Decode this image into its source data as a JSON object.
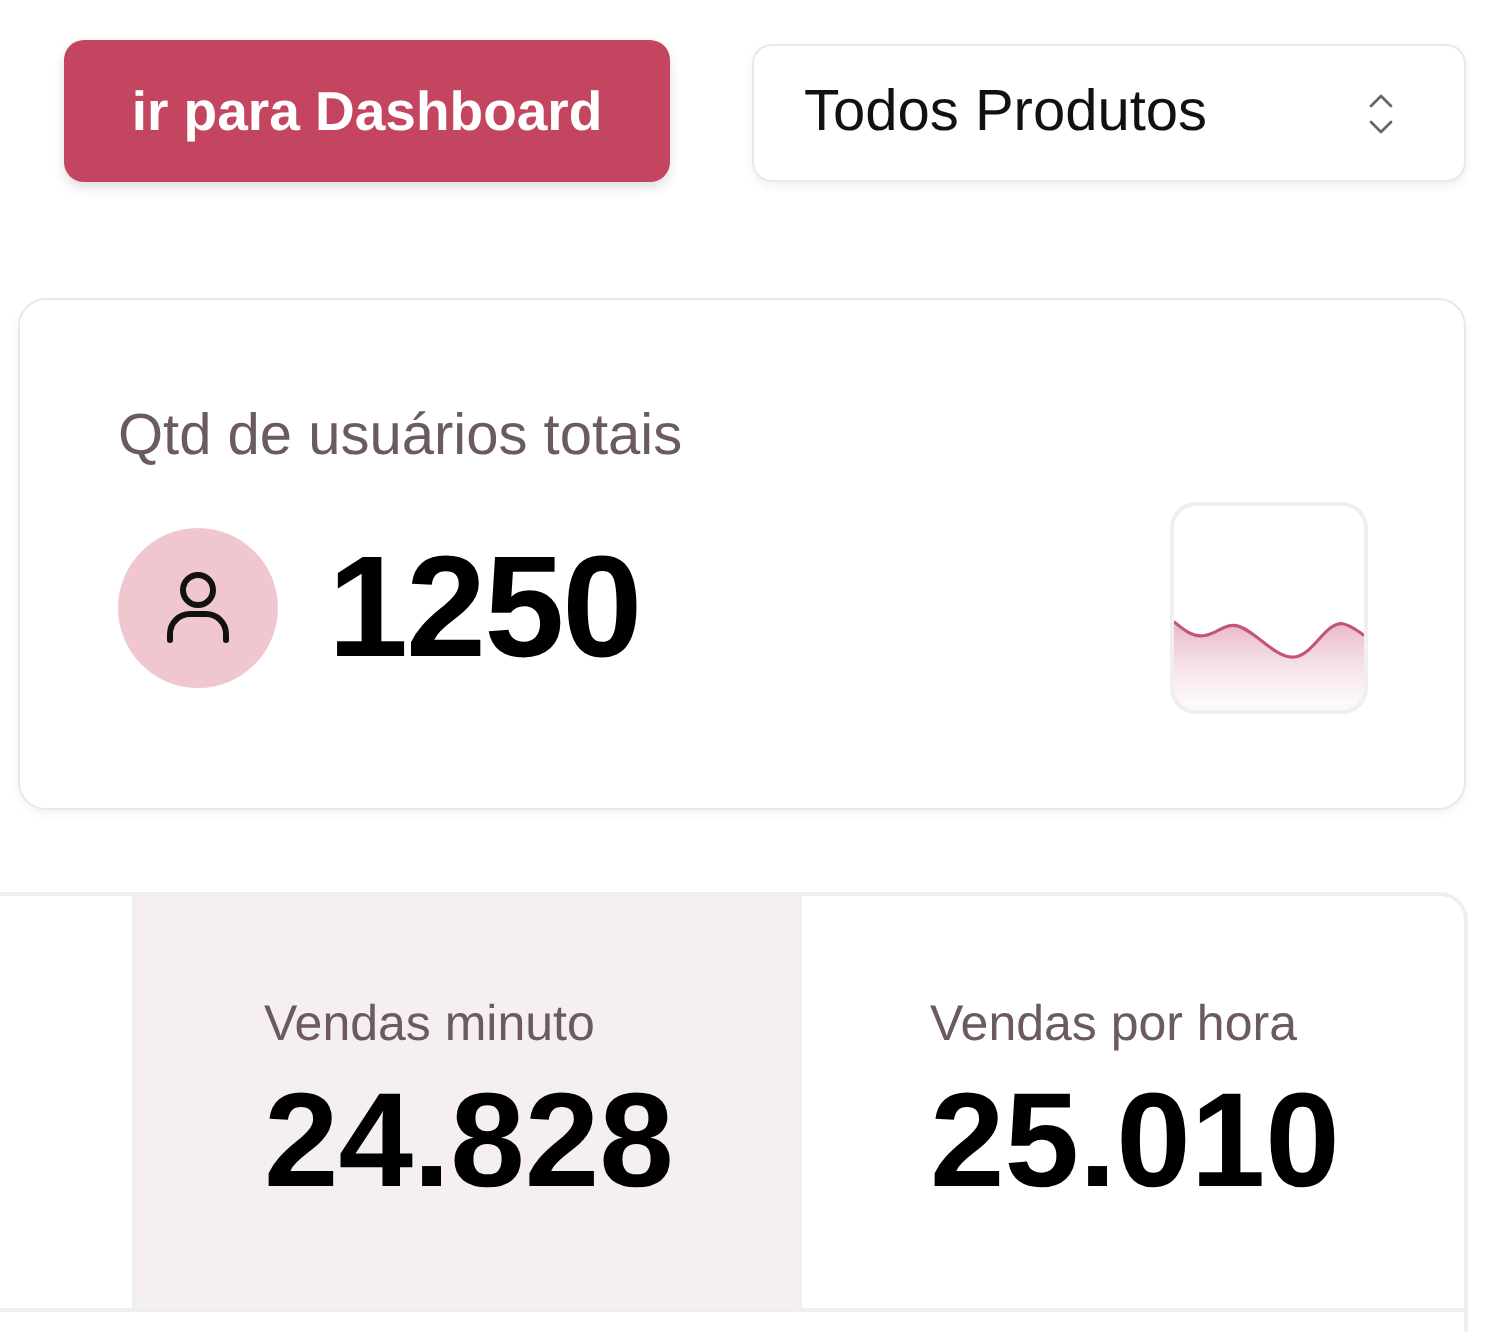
{
  "header": {
    "dashboard_button": {
      "label": "ir para Dashboard"
    },
    "product_select": {
      "value": "Todos Produtos"
    }
  },
  "users_card": {
    "title": "Qtd de usuários totais",
    "value": "1250"
  },
  "sales_stats": [
    {
      "label": "Vendas minuto",
      "value": "24.828",
      "selected": true
    },
    {
      "label": "Vendas por hora",
      "value": "25.010",
      "selected": false
    }
  ]
}
